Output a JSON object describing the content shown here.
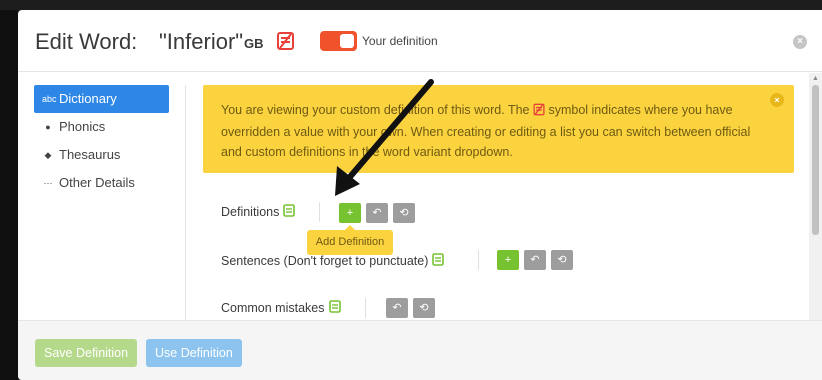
{
  "header": {
    "title_prefix": "Edit Word:",
    "title_word": "\"Inferior\"",
    "region": "GB",
    "toggle_label": "Your definition",
    "close_symbol": "×"
  },
  "sidebar": {
    "items": [
      {
        "label": "Dictionary",
        "icon": "abc-icon",
        "glyph": "abc",
        "active": true
      },
      {
        "label": "Phonics",
        "icon": "circle-info-icon",
        "glyph": "●"
      },
      {
        "label": "Thesaurus",
        "icon": "tag-icon",
        "glyph": "◆"
      },
      {
        "label": "Other Details",
        "icon": "ellipsis-icon",
        "glyph": "···"
      }
    ]
  },
  "notice": {
    "text_1": "You are viewing your custom definition of this word. The ",
    "text_2": " symbol indicates where you have overridden a value with your own. When creating or editing a list you can switch between official and custom definitions in the word variant dropdown.",
    "close_symbol": "×"
  },
  "sections": {
    "definitions": {
      "label": "Definitions"
    },
    "sentences": {
      "label": "Sentences (Don't forget to punctuate)"
    },
    "mistakes": {
      "label": "Common mistakes"
    }
  },
  "buttons": {
    "add": "+",
    "undo": "↶",
    "reset": "⟲"
  },
  "tooltip": {
    "text": "Add Definition"
  },
  "footer": {
    "save_label": "Save Definition",
    "use_label": "Use Definition"
  },
  "colors": {
    "accent_blue": "#2e86e6",
    "toggle_orange": "#f0522c",
    "notice_yellow": "#fad33f",
    "button_green": "#76c231"
  }
}
